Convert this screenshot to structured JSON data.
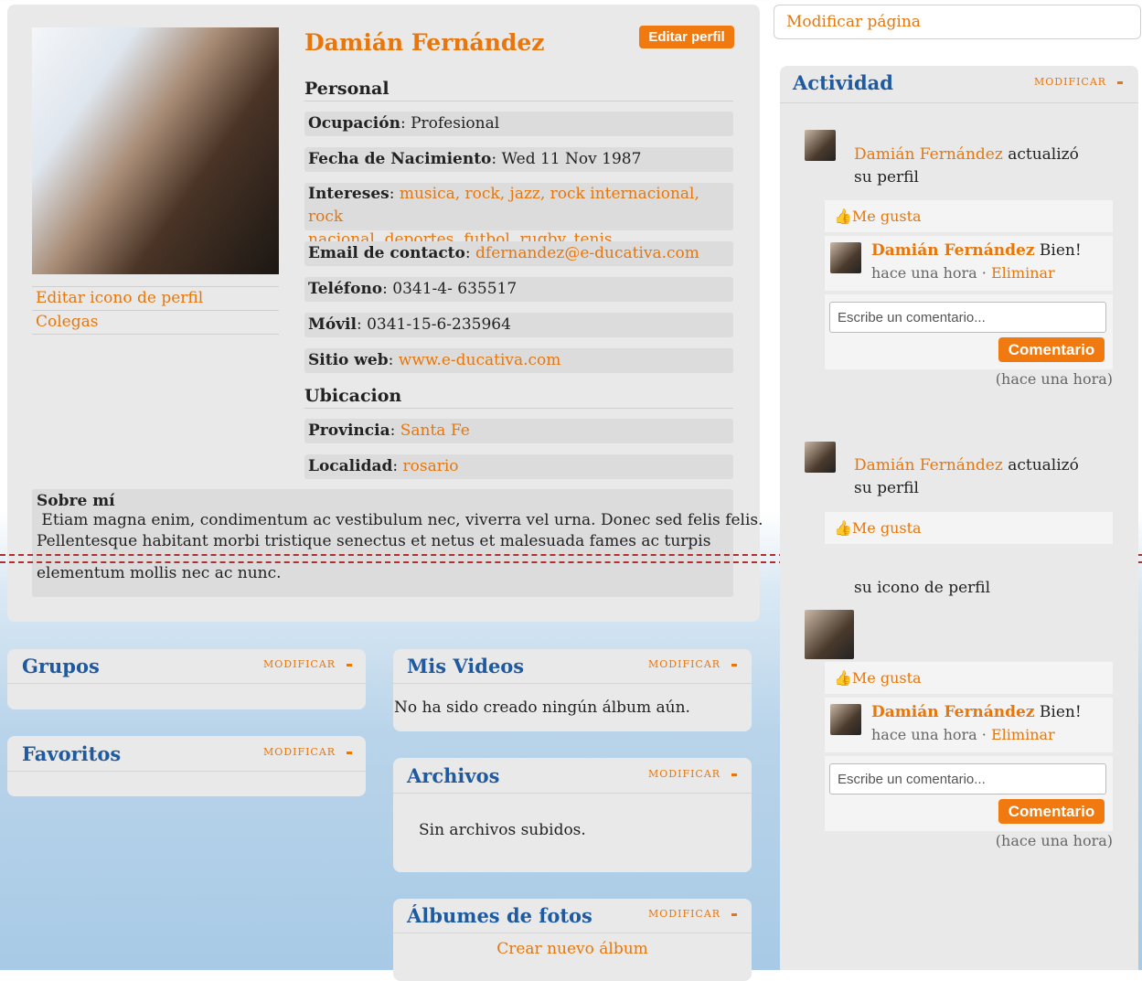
{
  "profile": {
    "name": "Damián Fernández",
    "edit_button": "Editar perfil",
    "side_links": [
      "Editar icono de perfil",
      "Colegas"
    ],
    "personal_header": "Personal",
    "occupation_label": "Ocupación",
    "occupation_value": "Profesional",
    "birth_label": "Fecha de Nacimiento",
    "birth_value": "Wed 11 Nov 1987",
    "interests_label": "Intereses",
    "interests_line1": "musica, rock, jazz, rock internacional, rock",
    "interests_line2": "nacional, deportes, futbol, rugby, tenis",
    "email_label": "Email de contacto",
    "email_value": "dfernandez@e-ducativa.com",
    "phone_label": "Teléfono",
    "phone_value": "0341-4- 635517",
    "mobile_label": "Móvil",
    "mobile_value": "0341-15-6-235964",
    "website_label": "Sitio web",
    "website_value": "www.e-ducativa.com",
    "location_header": "Ubicacion",
    "province_label": "Provincia",
    "province_value": "Santa Fe",
    "city_label": "Localidad",
    "city_value": "rosario",
    "about_header": "Sobre mí",
    "about_line1": " Etiam magna enim, condimentum ac vestibulum nec, viverra vel urna. Donec sed felis felis.",
    "about_line2": "Pellentesque habitant morbi tristique senectus et netus et malesuada fames ac turpis",
    "about_line3": "elementum mollis nec ac nunc."
  },
  "widgets": {
    "modify_label": "MODIFICAR",
    "groups_title": "Grupos",
    "favorites_title": "Favoritos",
    "videos_title": "Mis Videos",
    "videos_empty": "No ha sido creado ningún álbum aún.",
    "files_title": "Archivos",
    "files_empty": "Sin archivos subidos.",
    "albums_title": "Álbumes de fotos",
    "albums_create": "Crear nuevo álbum"
  },
  "sidebar": {
    "modify_page": "Modificar página",
    "activity_title": "Actividad",
    "modify_label": "MODIFICAR",
    "actor": "Damián Fernández",
    "action_profile_1": "actualizó",
    "action_profile_2": "su perfil",
    "action_icon_1": "actualizó",
    "action_icon_2": "su icono de perfil",
    "like": "Me gusta",
    "comment_text": "Bien!",
    "comment_time": "hace una hora",
    "delete": "Eliminar",
    "comment_placeholder": "Escribe un comentario...",
    "comment_button": "Comentario",
    "timestamp": "(hace una hora)"
  },
  "colors": {
    "accent": "#e8760a",
    "title_blue": "#1e5aa0",
    "panel": "#e9e9e9"
  }
}
